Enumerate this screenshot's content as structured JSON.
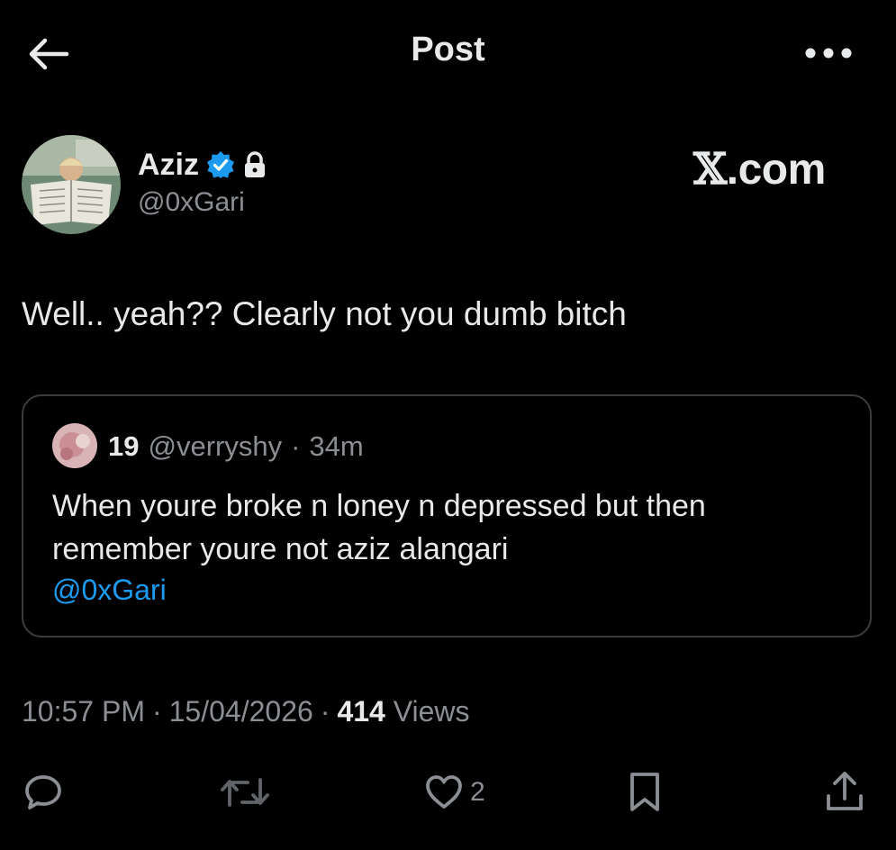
{
  "header": {
    "title": "Post",
    "back_icon": "arrow-left-icon",
    "more_icon": "more-horizontal-icon"
  },
  "author": {
    "name": "Aziz",
    "handle": "@0xGari",
    "verified_icon": "verified-badge-icon",
    "protected_icon": "lock-icon"
  },
  "brand": {
    "x_glyph": "𝕏",
    "suffix": ".com"
  },
  "tweet": {
    "text": "Well.. yeah?? Clearly not you dumb bitch"
  },
  "quote": {
    "name": "19",
    "handle": "@verryshy",
    "separator": "·",
    "time": "34m",
    "text": "When youre broke n loney n depressed but then remember youre not aziz alangari",
    "mention": "@0xGari"
  },
  "meta": {
    "time": "10:57 PM",
    "sep1": "·",
    "date": "15/04/2026",
    "sep2": "·",
    "views_count": "414",
    "views_label": "Views"
  },
  "actions": {
    "reply_icon": "reply-icon",
    "retweet_icon": "retweet-icon",
    "like_icon": "heart-icon",
    "like_count": "2",
    "bookmark_icon": "bookmark-icon",
    "share_icon": "share-icon"
  },
  "colors": {
    "background": "#000000",
    "text": "#e7e9ea",
    "muted": "#8b8f94",
    "accent": "#1d9bf0",
    "border": "#3a3d40"
  }
}
